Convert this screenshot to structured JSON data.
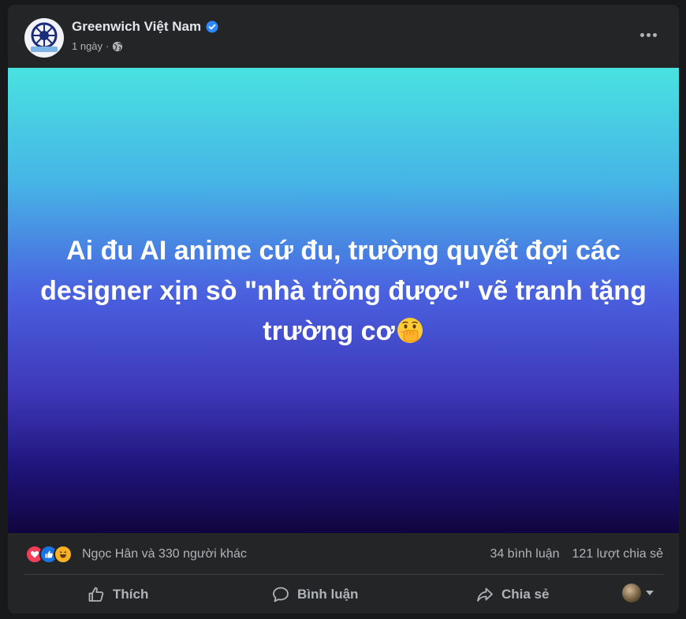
{
  "post": {
    "page_name": "Greenwich Việt Nam",
    "time": "1 ngày",
    "separator": "·",
    "text": "Ai đu AI anime cứ đu, trường quyết đợi các designer xịn sò \"nhà trồng được\" vẽ tranh tặng trường cơ",
    "emoji": "face-with-hand-over-mouth"
  },
  "stats": {
    "reactions": [
      "love",
      "like",
      "haha"
    ],
    "reactors_text": "Ngọc Hân và 330 người khác",
    "comments": "34 bình luận",
    "shares": "121 lượt chia sẻ"
  },
  "actions": {
    "like": "Thích",
    "comment": "Bình luận",
    "share": "Chia sẻ"
  },
  "colors": {
    "card_bg": "#242526",
    "text": "#e4e6eb",
    "secondary": "#b0b3b8",
    "verified": "#2d88ff",
    "gradient_top": "#49e2e0",
    "gradient_bottom": "#11053f"
  }
}
